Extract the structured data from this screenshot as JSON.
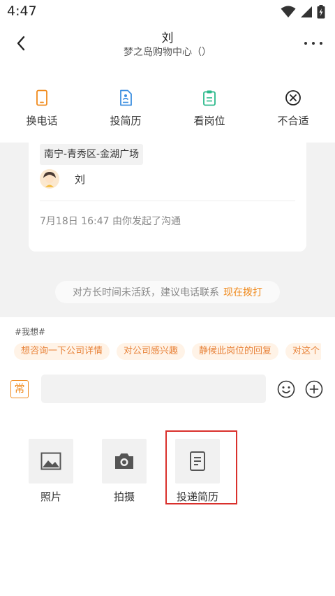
{
  "status_bar": {
    "time": "4:47"
  },
  "header": {
    "title": "刘",
    "subtitle": "梦之岛购物中心（）"
  },
  "quick_actions": [
    {
      "label": "换电话",
      "icon": "phone-icon",
      "color": "#f08a1c"
    },
    {
      "label": "投简历",
      "icon": "resume-icon",
      "color": "#3d8fe0"
    },
    {
      "label": "看岗位",
      "icon": "clipboard-icon",
      "color": "#2ab98a"
    },
    {
      "label": "不合适",
      "icon": "close-circle-icon",
      "color": "#222222"
    }
  ],
  "job_card": {
    "location": "南宁-青秀区-金湖广场",
    "contact_name": "刘",
    "timestamp": "7月18日 16:47 由你发起了沟通"
  },
  "notice": {
    "text": "对方长时间未活跃，建议电话联系",
    "action": "现在拨打"
  },
  "suggestions": {
    "hashtag": "#我想#",
    "chips": [
      "想咨询一下公司详情",
      "对公司感兴趣",
      "静候此岗位的回复",
      "对这个"
    ]
  },
  "input": {
    "common_label": "常",
    "placeholder": ""
  },
  "tools": [
    {
      "label": "照片",
      "icon": "image-icon"
    },
    {
      "label": "拍摄",
      "icon": "camera-icon"
    },
    {
      "label": "投递简历",
      "icon": "document-icon"
    }
  ],
  "colors": {
    "accent": "#f08a1c",
    "highlight": "#d9302c",
    "chip_bg": "#fff3e7"
  }
}
